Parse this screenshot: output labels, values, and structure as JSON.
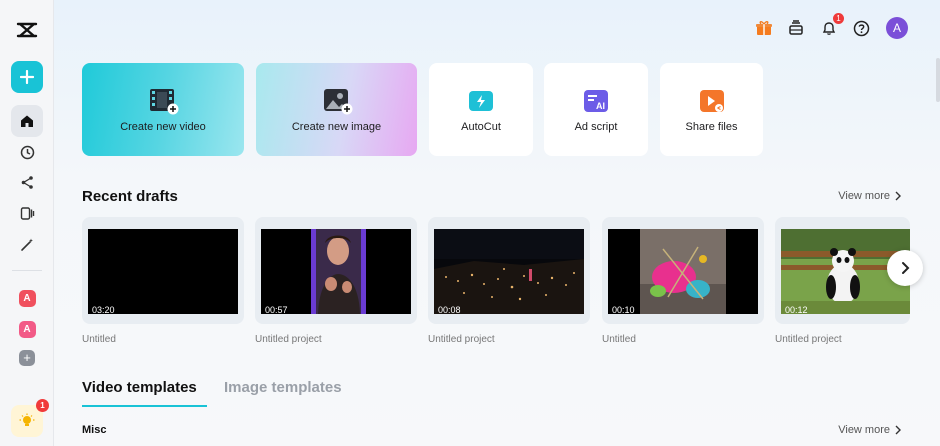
{
  "colors": {
    "accent": "#19c3d6",
    "badge_red": "#f03a3a",
    "avatar": "#7b4fd8"
  },
  "sidebar": {
    "items": [
      {
        "icon": "capcut-logo-icon"
      },
      {
        "icon": "plus-icon",
        "label": "+"
      },
      {
        "icon": "home-icon"
      },
      {
        "icon": "clock-icon"
      },
      {
        "icon": "share-icon"
      },
      {
        "icon": "media-icon"
      },
      {
        "icon": "magic-wand-icon"
      }
    ],
    "workspaces": [
      {
        "letter": "A"
      },
      {
        "letter": "A"
      }
    ],
    "add_workspace": "+",
    "bulb_count": "1"
  },
  "topbar": {
    "notification_count": "1",
    "avatar_letter": "A"
  },
  "quick_actions": [
    {
      "label": "Create new video",
      "icon": "film-plus-icon"
    },
    {
      "label": "Create new image",
      "icon": "image-plus-icon"
    },
    {
      "label": "AutoCut",
      "icon": "autocut-icon"
    },
    {
      "label": "Ad script",
      "icon": "ai-script-icon"
    },
    {
      "label": "Share files",
      "icon": "share-files-icon"
    }
  ],
  "recent": {
    "title": "Recent drafts",
    "view_more": "View more",
    "drafts": [
      {
        "name": "Untitled",
        "duration": "03:20"
      },
      {
        "name": "Untitled project",
        "duration": "00:57"
      },
      {
        "name": "Untitled project",
        "duration": "00:08"
      },
      {
        "name": "Untitled",
        "duration": "00:10"
      },
      {
        "name": "Untitled project",
        "duration": "00:12"
      }
    ]
  },
  "templates": {
    "tabs": [
      {
        "label": "Video templates",
        "active": true
      },
      {
        "label": "Image templates",
        "active": false
      }
    ],
    "section": "Misc",
    "view_more": "View more"
  }
}
